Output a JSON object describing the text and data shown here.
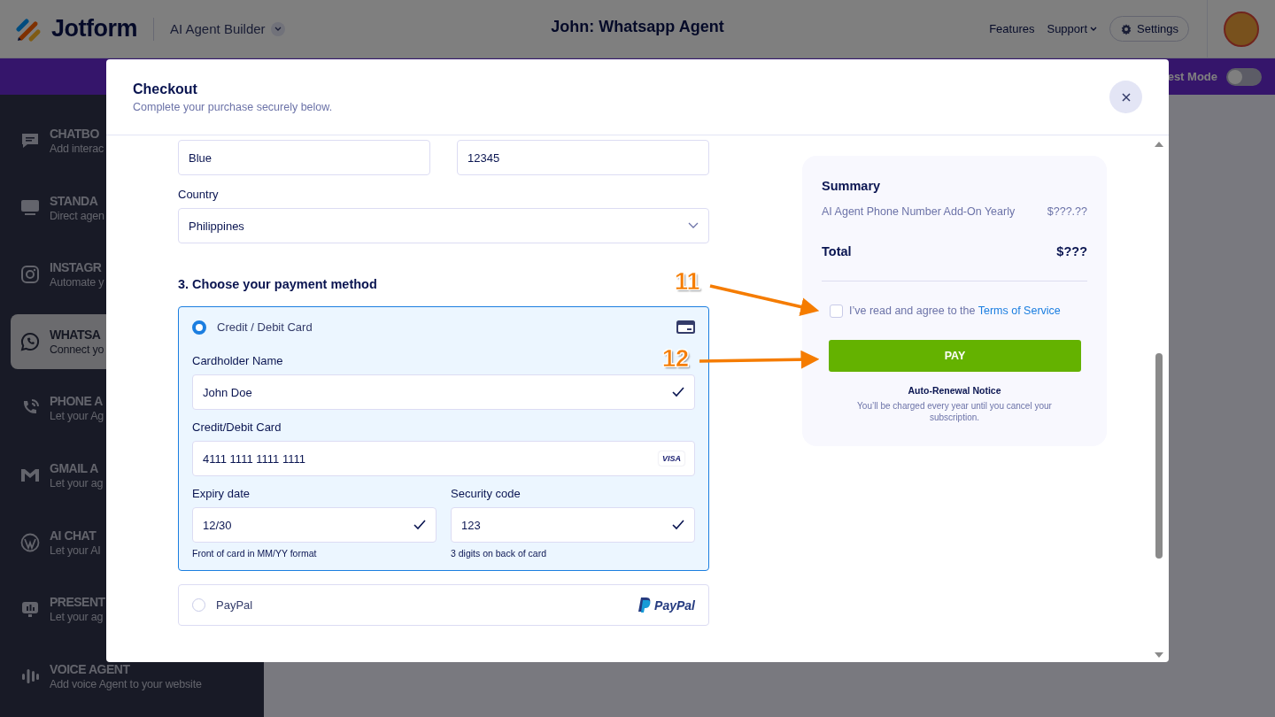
{
  "header": {
    "logo": "Jotform",
    "app_menu": "AI Agent Builder",
    "title": "John: Whatsapp Agent",
    "links": [
      {
        "label": "Features",
        "dropdown": false
      },
      {
        "label": "Support",
        "dropdown": true
      }
    ],
    "settings": "Settings"
  },
  "test_mode": {
    "label": "est Mode",
    "on": false
  },
  "sidebar": {
    "items": [
      {
        "title": "CHATBO",
        "subtitle": "Add interac",
        "selected": false
      },
      {
        "title": "STANDA",
        "subtitle": "Direct agen",
        "selected": false
      },
      {
        "title": "INSTAGR",
        "subtitle": "Automate y",
        "selected": false
      },
      {
        "title": "WHATSA",
        "subtitle": "Connect yo",
        "selected": true
      },
      {
        "title": "PHONE A",
        "subtitle": "Let your Ag",
        "selected": false
      },
      {
        "title": "GMAIL A",
        "subtitle": "Let your ag",
        "selected": false
      },
      {
        "title": "AI CHAT",
        "subtitle": "Let your AI",
        "selected": false
      },
      {
        "title": "PRESENT",
        "subtitle": "Let your ag",
        "selected": false
      },
      {
        "title": "VOICE AGENT",
        "subtitle": "Add voice Agent to your website",
        "selected": false
      }
    ]
  },
  "checkout": {
    "title": "Checkout",
    "subtitle": "Complete your purchase securely below.",
    "address_fields": [
      {
        "value": "Blue"
      },
      {
        "value": "12345"
      }
    ],
    "country": {
      "label": "Country",
      "value": "Philippines"
    },
    "payment_heading": "3. Choose your payment method",
    "methods": [
      {
        "kind": "card",
        "label": "Credit / Debit Card",
        "selected": true
      },
      {
        "kind": "paypal",
        "label": "PayPal",
        "logo": "PayPal",
        "selected": false
      }
    ],
    "card": {
      "name": {
        "label": "Cardholder Name",
        "value": "John Doe",
        "valid": true
      },
      "number": {
        "label": "Credit/Debit Card",
        "value": "4111 1111 1111 1111",
        "brand": "VISA"
      },
      "expiry": {
        "label": "Expiry date",
        "value": "12/30",
        "hint": "Front of card in MM/YY format",
        "valid": true
      },
      "security": {
        "label": "Security code",
        "value": "123",
        "hint": "3 digits on back of card",
        "valid": true
      }
    },
    "summary": {
      "title": "Summary",
      "items": [
        {
          "name": "AI Agent Phone Number Add-On Yearly",
          "price": "$???.??"
        }
      ],
      "total_label": "Total",
      "total": "$???",
      "agree": {
        "text": "I’ve read and agree to the ",
        "link": "Terms of Service",
        "checked": false
      },
      "pay": "PAY",
      "notice_title": "Auto-Renewal Notice",
      "notice_text": "You’ll be charged every year until you cancel your subscription."
    }
  },
  "annotations": [
    {
      "label": "11"
    },
    {
      "label": "12"
    }
  ]
}
